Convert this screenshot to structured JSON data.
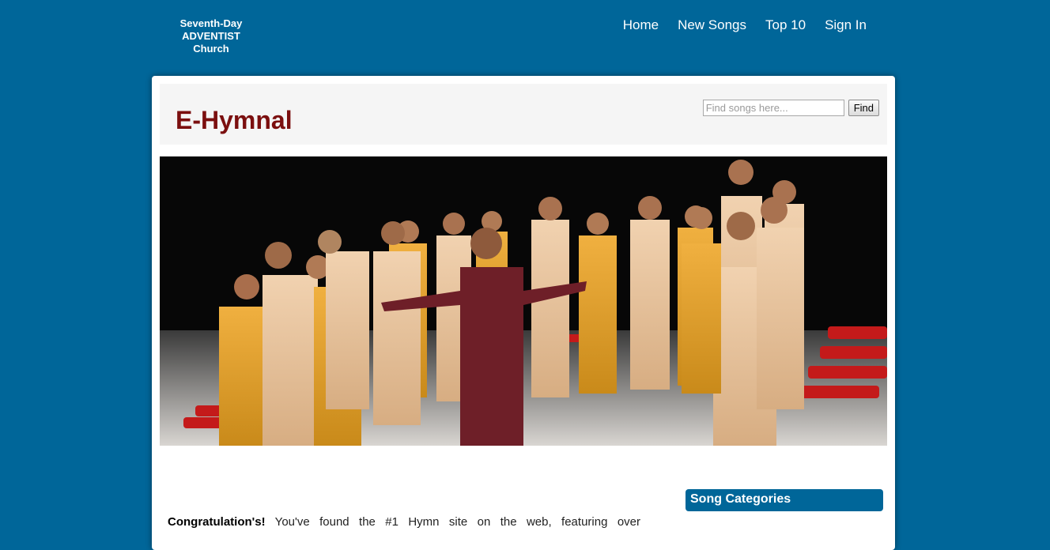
{
  "logo": {
    "line1": "Seventh-Day",
    "line2": "ADVENTIST",
    "line3": "Church"
  },
  "nav": {
    "items": [
      {
        "label": "Home"
      },
      {
        "label": "New Songs"
      },
      {
        "label": "Top 10"
      },
      {
        "label": "Sign In"
      }
    ]
  },
  "header": {
    "title": "E-Hymnal",
    "search_placeholder": "Find songs here...",
    "find_label": "Find"
  },
  "intro": {
    "strong": "Congratulation's!",
    "text": " You've found the #1 Hymn site on the web, featuring over"
  },
  "sidebar": {
    "heading": "Song Categories"
  },
  "colors": {
    "page_background": "#006699",
    "title_color": "#7b0f0f",
    "category_header": "#006699"
  }
}
